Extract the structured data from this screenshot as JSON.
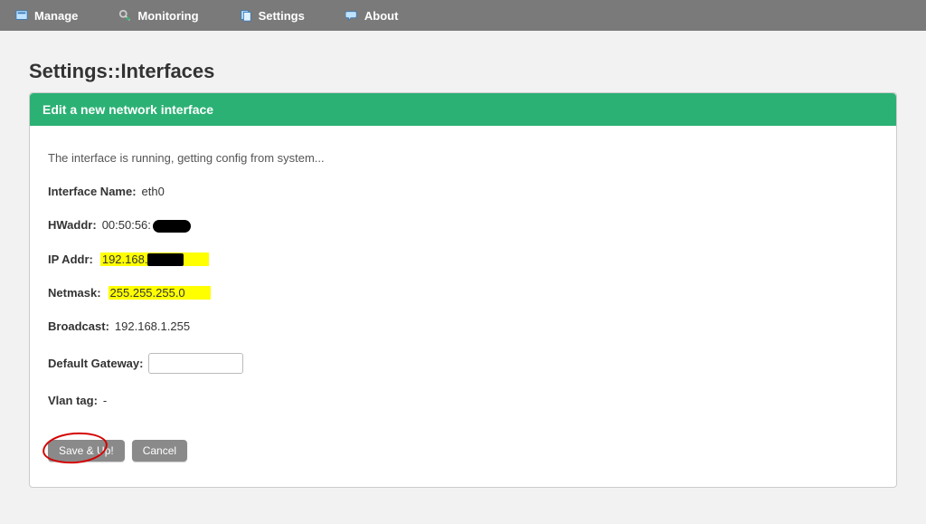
{
  "nav": {
    "manage": "Manage",
    "monitoring": "Monitoring",
    "settings": "Settings",
    "about": "About"
  },
  "page": {
    "title": "Settings::Interfaces"
  },
  "panel": {
    "header": "Edit a new network interface",
    "status": "The interface is running, getting config from system..."
  },
  "fields": {
    "interface_name_label": "Interface Name:",
    "interface_name_value": "eth0",
    "hwaddr_label": "HWaddr:",
    "hwaddr_value_prefix": "00:50:56:",
    "ipaddr_label": "IP Addr:",
    "ipaddr_value_prefix": "192.168.",
    "netmask_label": "Netmask:",
    "netmask_value": "255.255.255.0",
    "broadcast_label": "Broadcast:",
    "broadcast_value": "192.168.1.255",
    "gateway_label": "Default Gateway:",
    "gateway_value": "",
    "vlan_label": "Vlan tag:",
    "vlan_value": "-"
  },
  "buttons": {
    "save_up": "Save & Up!",
    "cancel": "Cancel"
  }
}
